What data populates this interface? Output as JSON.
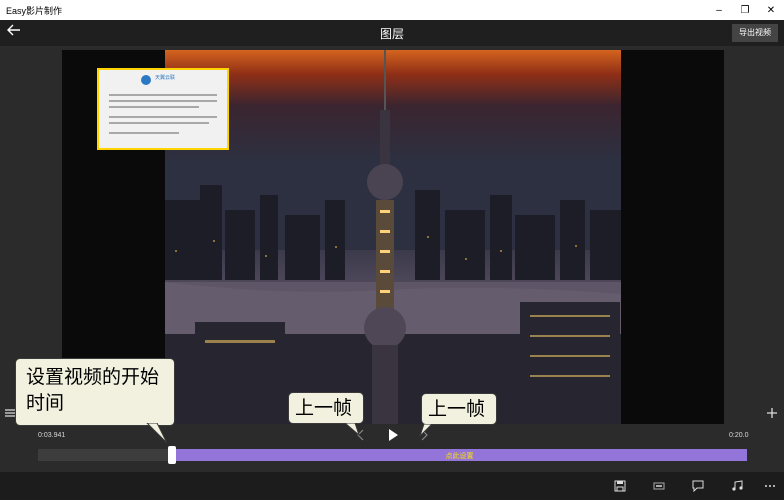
{
  "window": {
    "title": "Easy影片制作"
  },
  "window_controls": {
    "minimize": "–",
    "maximize": "❐",
    "close": "✕"
  },
  "header": {
    "title": "图层",
    "export_label": "导出视频"
  },
  "timeline": {
    "start_time": "0:03.941",
    "end_time": "0:20.0",
    "bar_label": "点此设置",
    "bar_color": "#9375d9",
    "label_color": "#ffe100"
  },
  "callouts": {
    "set_start": "设置视频的开始时间",
    "prev_frame_1": "上一帧",
    "prev_frame_2": "上一帧"
  },
  "overlay": {
    "brand": "天翼云联",
    "border_color": "#ffd400"
  },
  "icons": {
    "back": "arrow-left-icon",
    "list": "list-icon",
    "add": "plus-icon",
    "prev": "chevron-left-icon",
    "play": "play-icon",
    "next": "chevron-right-icon",
    "save": "save-icon",
    "screen": "aspect-ratio-icon",
    "text": "text-bubble-icon",
    "music": "music-icon",
    "more": "more-icon"
  }
}
